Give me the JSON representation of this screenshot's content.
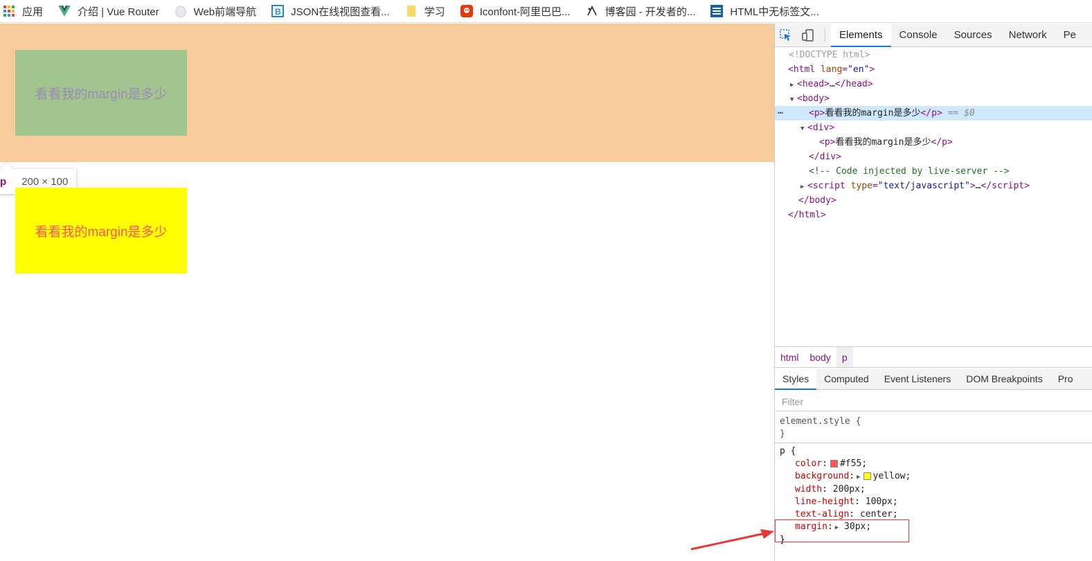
{
  "bookmarks": [
    {
      "label": "应用",
      "icon": "apps-grid-icon"
    },
    {
      "label": "介绍 | Vue Router",
      "icon": "vue-logo-icon"
    },
    {
      "label": "Web前端导航",
      "icon": "egg-icon"
    },
    {
      "label": "JSON在线视图查看...",
      "icon": "b-logo-icon"
    },
    {
      "label": "学习",
      "icon": "folder-icon"
    },
    {
      "label": "Iconfont-阿里巴巴...",
      "icon": "iconfont-logo-icon"
    },
    {
      "label": "博客园 - 开发者的...",
      "icon": "cnblogs-logo-icon"
    },
    {
      "label": "HTML中无标签文...",
      "icon": "site-logo-icon"
    }
  ],
  "page": {
    "highlighted_text": "看看我的margin是多少",
    "paragraph_text": "看看我的margin是多少",
    "tooltip_tag": "p",
    "tooltip_size": "200 × 100",
    "colors": {
      "margin_overlay": "#f8cb9c",
      "content_overlay": "#a2c48e",
      "p_background": "#ffff00",
      "p_color": "#ff5555"
    }
  },
  "devtools": {
    "tabs": [
      "Elements",
      "Console",
      "Sources",
      "Network",
      "Pe"
    ],
    "active_tab": "Elements",
    "dom": {
      "doctype": "<!DOCTYPE html>",
      "html_open_tag": "html",
      "html_attr": "lang",
      "html_attr_val": "\"en\"",
      "head": "head",
      "head_ellipsis": "…",
      "head_close": "/head",
      "body": "body",
      "p_tag": "p",
      "p_text": "看看我的margin是多少",
      "p_close": "/p",
      "selected_marker": "== $0",
      "div": "div",
      "inner_p_text": "看看我的margin是多少",
      "div_close": "/div",
      "comment": "<!-- Code injected by live-server -->",
      "script_tag": "script",
      "script_attr": "type",
      "script_attr_val": "\"text/javascript\"",
      "script_ellipsis": "…",
      "script_close": "/script",
      "body_close": "/body",
      "html_close": "/html",
      "dots": "⋯"
    },
    "breadcrumbs": [
      "html",
      "body",
      "p"
    ],
    "style_tabs": [
      "Styles",
      "Computed",
      "Event Listeners",
      "DOM Breakpoints",
      "Pro"
    ],
    "filter_placeholder": "Filter",
    "element_style": {
      "selector": "element.style {",
      "close": "}"
    },
    "p_rule": {
      "selector": "p {",
      "close": "}",
      "props": [
        {
          "name": "color",
          "value": "#f55;",
          "swatch": "#ff5555"
        },
        {
          "name": "background",
          "value": "yellow;",
          "swatch": "#ffff00"
        },
        {
          "name": "width",
          "value": "200px;"
        },
        {
          "name": "line-height",
          "value": "100px;"
        },
        {
          "name": "text-align",
          "value": "center;"
        },
        {
          "name": "margin",
          "value": "30px;"
        }
      ]
    },
    "accent_color": "#1a73e8",
    "annotation_color": "#e53935"
  }
}
